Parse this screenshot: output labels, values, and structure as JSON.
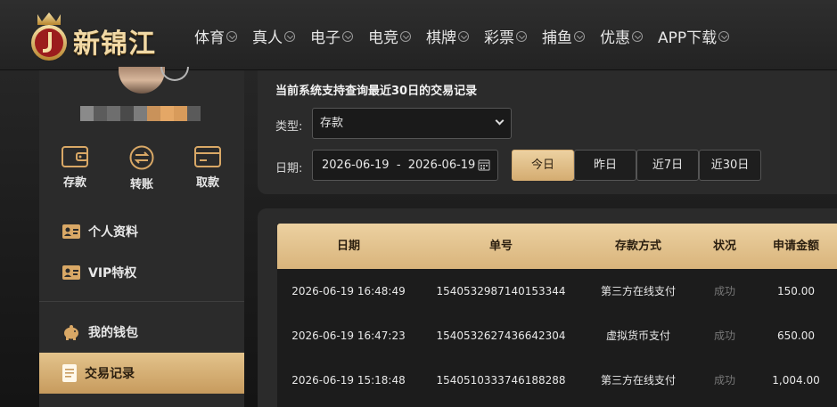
{
  "header": {
    "logo_text": "新锦江",
    "nav": [
      "体育",
      "真人",
      "电子",
      "电竞",
      "棋牌",
      "彩票",
      "捕鱼",
      "优惠",
      "APP下载"
    ]
  },
  "sidebar": {
    "quick_actions": [
      {
        "label": "存款",
        "icon": "wallet-icon"
      },
      {
        "label": "转账",
        "icon": "transfer-icon"
      },
      {
        "label": "取款",
        "icon": "card-icon"
      }
    ],
    "menu": [
      {
        "label": "个人资料",
        "icon": "id-card-icon"
      },
      {
        "label": "VIP特权",
        "icon": "vip-card-icon"
      },
      {
        "label": "我的钱包",
        "icon": "piggy-bank-icon"
      },
      {
        "label": "交易记录",
        "icon": "document-icon",
        "active": true
      }
    ]
  },
  "filter": {
    "hint": "当前系统支持查询最近30日的交易记录",
    "type_label": "类型:",
    "type_value": "存款",
    "date_label": "日期:",
    "date_range": "2026-06-19  -  2026-06-19",
    "quick_buttons": [
      "今日",
      "昨日",
      "近7日",
      "近30日"
    ],
    "active_button": "今日"
  },
  "table": {
    "headers": [
      "日期",
      "单号",
      "存款方式",
      "状况",
      "申请金额"
    ],
    "rows": [
      [
        "2026-06-19 16:48:49",
        "1540532987140153344",
        "第三方在线支付",
        "成功",
        "150.00"
      ],
      [
        "2026-06-19 16:47:23",
        "1540532627436642304",
        "虚拟货币支付",
        "成功",
        "650.00"
      ],
      [
        "2026-06-19 15:18:48",
        "1540510333746188288",
        "第三方在线支付",
        "成功",
        "1,004.00"
      ]
    ]
  },
  "colors": {
    "accent_gold": "#d9b47b",
    "panel": "#2b2b2b",
    "status_success": "#777777"
  }
}
